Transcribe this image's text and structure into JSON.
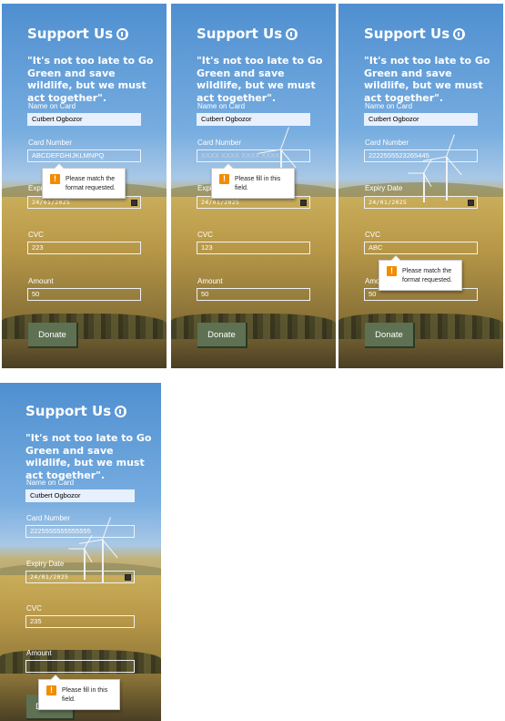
{
  "colors": {
    "accent": "#5e7152",
    "warning": "#f28c00",
    "autofill": "#e8f0fe",
    "sky": "#4f8fd0"
  },
  "form": {
    "title": "Support Us",
    "title_icon": "donate-hand-icon",
    "quote": "\"It's not too late to Go Green and save wildlife, but we must act together\".",
    "labels": {
      "name": "Name on Card",
      "card": "Card Number",
      "expiry": "Expiry Date",
      "cvc": "CVC",
      "amount": "Amount"
    },
    "donate_label": "Donate",
    "card_placeholder": "XXXX XXXX XXXX XXXX"
  },
  "panels": [
    {
      "name_value": "Cutbert Ogbozor",
      "card_value": "ABCDEFGHIJKLMNPQ",
      "expiry_value": "24/01/2025",
      "cvc_value": "223",
      "amount_value": "50",
      "tooltip": "Please match the format requested."
    },
    {
      "name_value": "Cutbert Ogbozor",
      "card_value": "",
      "expiry_value": "24/01/2025",
      "cvc_value": "123",
      "amount_value": "50",
      "tooltip": "Please fill in this field."
    },
    {
      "name_value": "Cutbert Ogbozor",
      "card_value": "2222555523265445",
      "expiry_value": "24/01/2025",
      "cvc_value": "ABC",
      "amount_value": "50",
      "tooltip": "Please match the format requested."
    },
    {
      "name_value": "Cutbert Ogbozor",
      "card_value": "2225555555555555",
      "expiry_value": "24/01/2025",
      "cvc_value": "235",
      "amount_value": "",
      "tooltip": "Please fill in this field."
    }
  ]
}
